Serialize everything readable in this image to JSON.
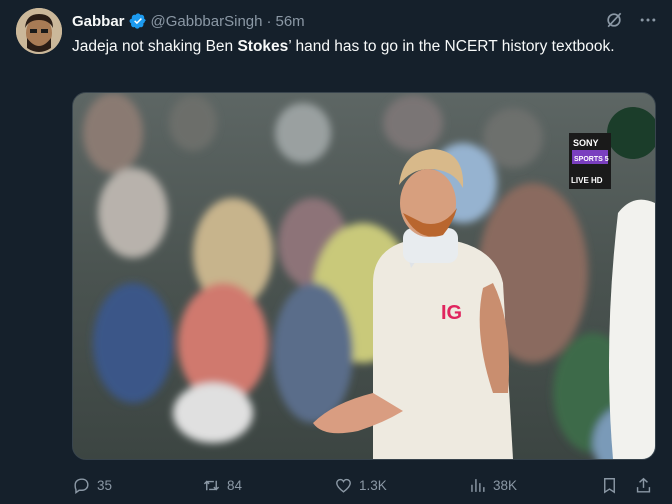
{
  "author": {
    "name": "Gabbar",
    "handle": "@GabbbarSingh",
    "separator": "·",
    "time": "56m",
    "verified": true
  },
  "tweet": {
    "text_before": "Jadeja not shaking Ben ",
    "text_bold": "Stokes",
    "text_after": "’ hand has to go in the NCERT history textbook."
  },
  "media": {
    "jersey_text": "IG",
    "broadcaster": {
      "brand": "SONY",
      "channel": "SPORTS 5",
      "tag": "LIVE HD"
    }
  },
  "actions": {
    "replies": "35",
    "reposts": "84",
    "likes": "1.3K",
    "views": "38K"
  },
  "icons": {
    "verified": "verified-badge-icon",
    "grok": "grok-icon",
    "more": "more-icon",
    "reply": "reply-icon",
    "repost": "repost-icon",
    "like": "heart-icon",
    "views": "views-icon",
    "bookmark": "bookmark-icon",
    "share": "share-icon"
  },
  "colors": {
    "background": "#15202b",
    "text": "#f7f9f9",
    "muted": "#8b98a5",
    "verified_blue": "#1d9bf0",
    "live_red": "#e0245e"
  }
}
